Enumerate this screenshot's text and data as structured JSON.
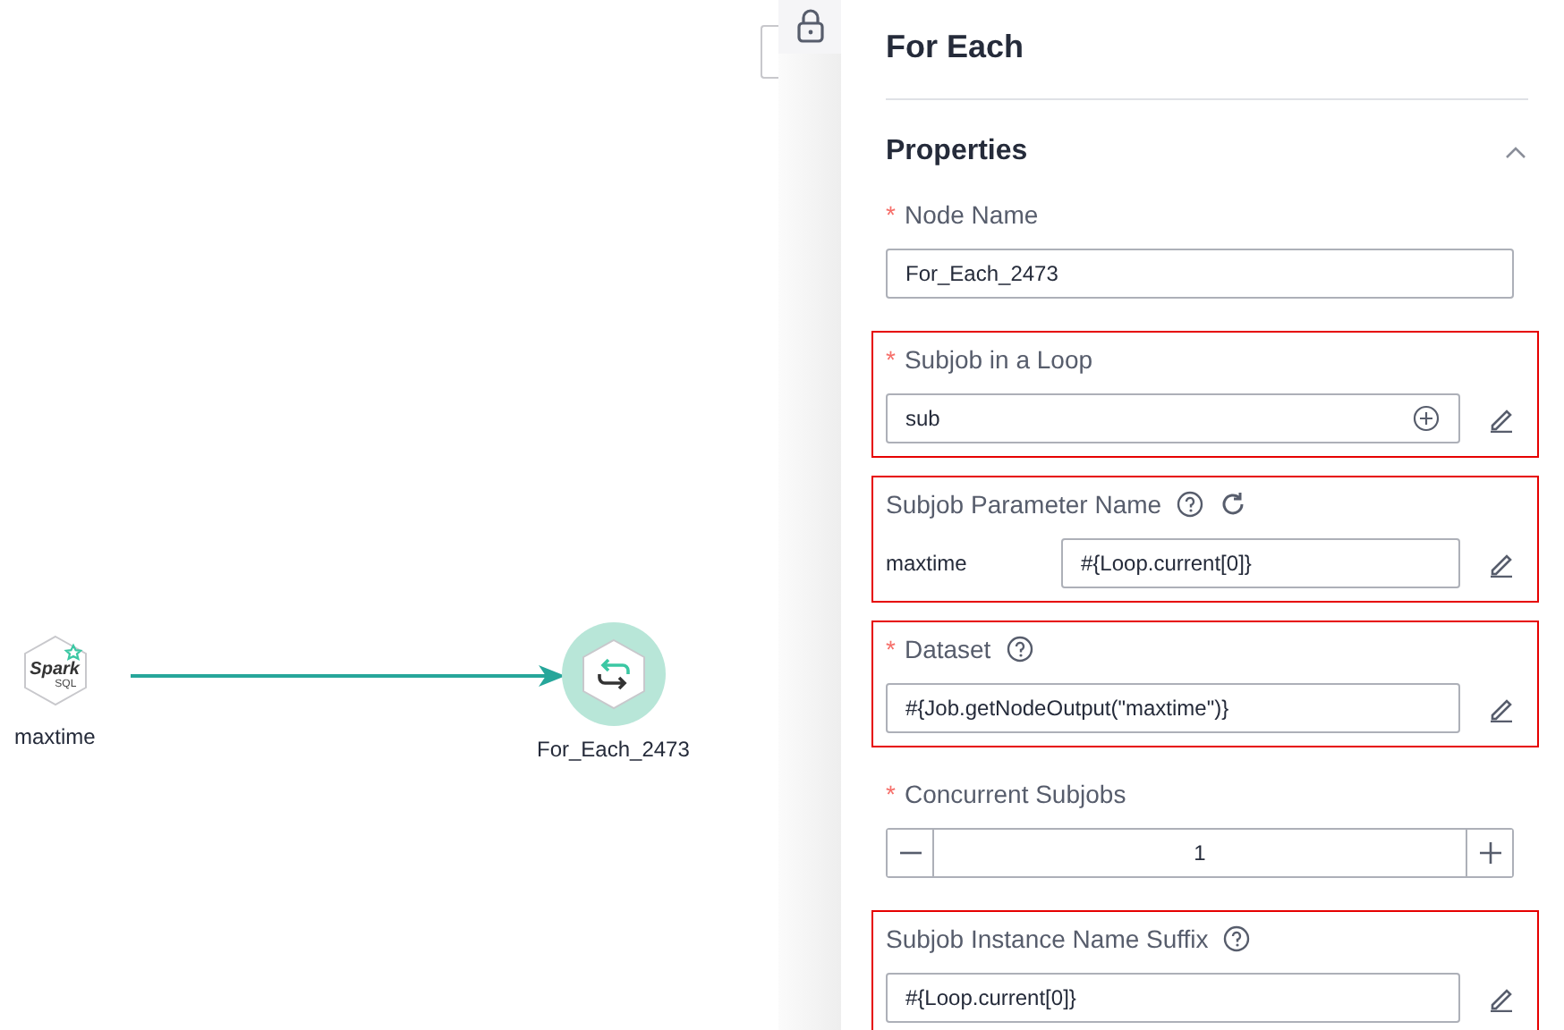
{
  "canvas": {
    "nodes": [
      {
        "kind": "spark",
        "label": "maxtime",
        "logo_text": "Spark",
        "logo_sub": "SQL",
        "selected": false
      },
      {
        "kind": "loop",
        "label": "For_Each_2473",
        "selected": true
      }
    ]
  },
  "panel": {
    "title": "For Each",
    "section": {
      "title": "Properties",
      "expanded": true
    },
    "fields": [
      {
        "kind": "text",
        "label": "Node Name",
        "marker": "*",
        "value": "For_Each_2473"
      },
      {
        "kind": "select",
        "label": "Subjob in a Loop",
        "marker": "*",
        "highlighted": true,
        "value": "sub"
      },
      {
        "kind": "param",
        "label": "Subjob Parameter Name",
        "highlighted": true,
        "help": true,
        "refresh": true,
        "param": "maxtime",
        "value": "#{Loop.current[0]}"
      },
      {
        "kind": "edit",
        "label": "Dataset",
        "marker": "*",
        "highlighted": true,
        "help": true,
        "value": "#{Job.getNodeOutput(\"maxtime\")}"
      },
      {
        "kind": "stepper",
        "label": "Concurrent Subjobs",
        "marker": "*",
        "value": "1"
      },
      {
        "kind": "edit",
        "label": "Subjob Instance Name Suffix",
        "highlighted": true,
        "help": true,
        "value": "#{Loop.current[0]}"
      }
    ]
  }
}
